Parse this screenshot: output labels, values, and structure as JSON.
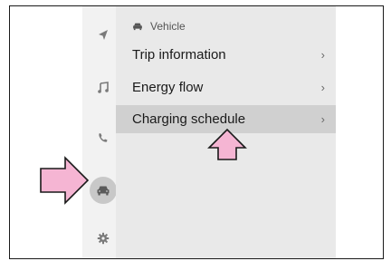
{
  "sidebar": {
    "items": [
      {
        "icon": "navigation-arrow-icon"
      },
      {
        "icon": "music-note-icon"
      },
      {
        "icon": "phone-icon"
      },
      {
        "icon": "car-icon",
        "selected": true
      },
      {
        "icon": "gear-icon"
      }
    ]
  },
  "main": {
    "header": {
      "icon": "car-icon",
      "label": "Vehicle"
    },
    "items": [
      {
        "label": "Trip information",
        "chevron": "›"
      },
      {
        "label": "Energy flow",
        "chevron": "›"
      },
      {
        "label": "Charging schedule",
        "chevron": "›",
        "selected": true
      }
    ]
  },
  "callouts": [
    {
      "type": "arrow",
      "direction": "right",
      "target": "sidebar-vehicle"
    },
    {
      "type": "arrow",
      "direction": "up",
      "target": "charging-schedule"
    }
  ],
  "colors": {
    "callout_fill": "#f5b5d3",
    "callout_stroke": "#1a1a1a",
    "selected_row": "#d0d0d0",
    "panel": "#e9e9e9",
    "sidebar": "#f2f2f2"
  }
}
